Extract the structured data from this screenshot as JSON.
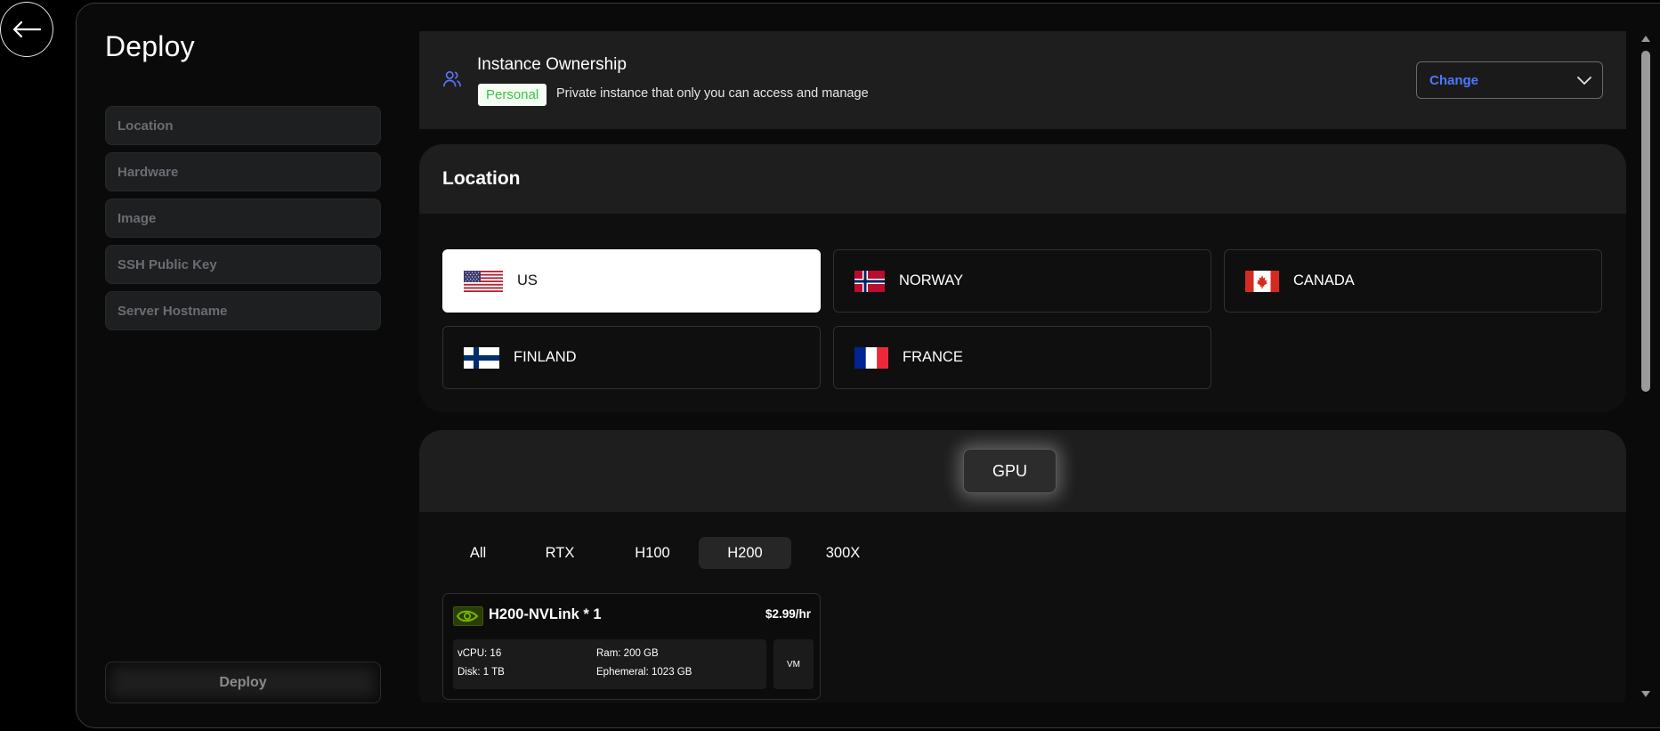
{
  "page": {
    "title": "Deploy"
  },
  "steps": [
    {
      "label": "Location"
    },
    {
      "label": "Hardware"
    },
    {
      "label": "Image"
    },
    {
      "label": "SSH Public Key"
    },
    {
      "label": "Server Hostname"
    }
  ],
  "deploy": {
    "label": "Deploy"
  },
  "ownership": {
    "title": "Instance Ownership",
    "badge": "Personal",
    "description": "Private instance that only you can access and manage",
    "change_label": "Change"
  },
  "location": {
    "title": "Location",
    "selected": "US",
    "options": [
      {
        "name": "US",
        "flag": "us-flag-icon"
      },
      {
        "name": "NORWAY",
        "flag": "norway-flag-icon"
      },
      {
        "name": "CANADA",
        "flag": "canada-flag-icon"
      },
      {
        "name": "FINLAND",
        "flag": "finland-flag-icon"
      },
      {
        "name": "FRANCE",
        "flag": "france-flag-icon"
      }
    ]
  },
  "hardware": {
    "type_label": "GPU",
    "tabs": [
      {
        "label": "All"
      },
      {
        "label": "RTX"
      },
      {
        "label": "H100"
      },
      {
        "label": "H200"
      },
      {
        "label": "300X"
      }
    ],
    "active_tab": "H200",
    "gpus": [
      {
        "name": "H200-NVLink * 1",
        "price": "$2.99/hr",
        "vcpu": "vCPU: 16",
        "ram": "Ram: 200 GB",
        "disk": "Disk: 1 TB",
        "ephemeral": "Ephemeral: 1023 GB",
        "kind": "VM"
      }
    ]
  },
  "colors": {
    "accent": "#4d79ff",
    "badge_text": "#3bbf46",
    "nvidia_green": "#76b900"
  }
}
